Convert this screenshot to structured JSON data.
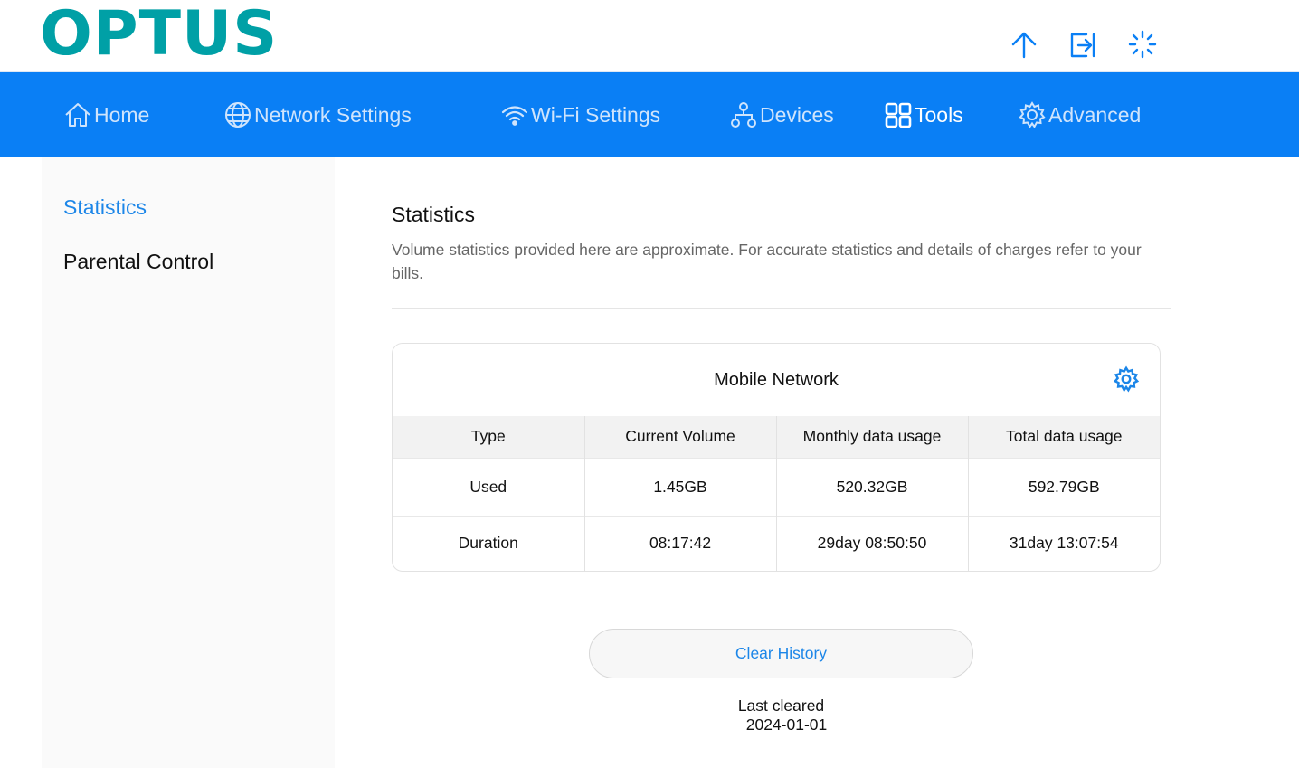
{
  "brand": {
    "logo_text": "OPTUS",
    "logo_color": "#00a0a6",
    "accent": "#0a7ff5",
    "link_color": "#1c86e8"
  },
  "header_icons": [
    "upload-arrow-icon",
    "logout-icon",
    "loading-spinner-icon"
  ],
  "nav": {
    "items": [
      {
        "label": "Home",
        "icon": "home-icon"
      },
      {
        "label": "Network Settings",
        "icon": "globe-icon"
      },
      {
        "label": "Wi-Fi Settings",
        "icon": "wifi-icon"
      },
      {
        "label": "Devices",
        "icon": "devices-icon"
      },
      {
        "label": "Tools",
        "icon": "tools-grid-icon",
        "active": true
      },
      {
        "label": "Advanced",
        "icon": "gear-icon"
      }
    ]
  },
  "sidebar": {
    "items": [
      {
        "label": "Statistics",
        "active": true
      },
      {
        "label": "Parental Control",
        "active": false
      }
    ]
  },
  "main": {
    "title": "Statistics",
    "description": "Volume statistics provided here are approximate. For accurate statistics and details of charges refer to your bills.",
    "card": {
      "title": "Mobile Network",
      "headers": [
        "Type",
        "Current Volume",
        "Monthly data usage",
        "Total data usage"
      ],
      "rows": [
        [
          "Used",
          "1.45GB",
          "520.32GB",
          "592.79GB"
        ],
        [
          "Duration",
          "08:17:42",
          "29day 08:50:50",
          "31day 13:07:54"
        ]
      ]
    },
    "clear_button": "Clear History",
    "last_cleared_label": "Last cleared",
    "last_cleared_date": "2024-01-01"
  }
}
